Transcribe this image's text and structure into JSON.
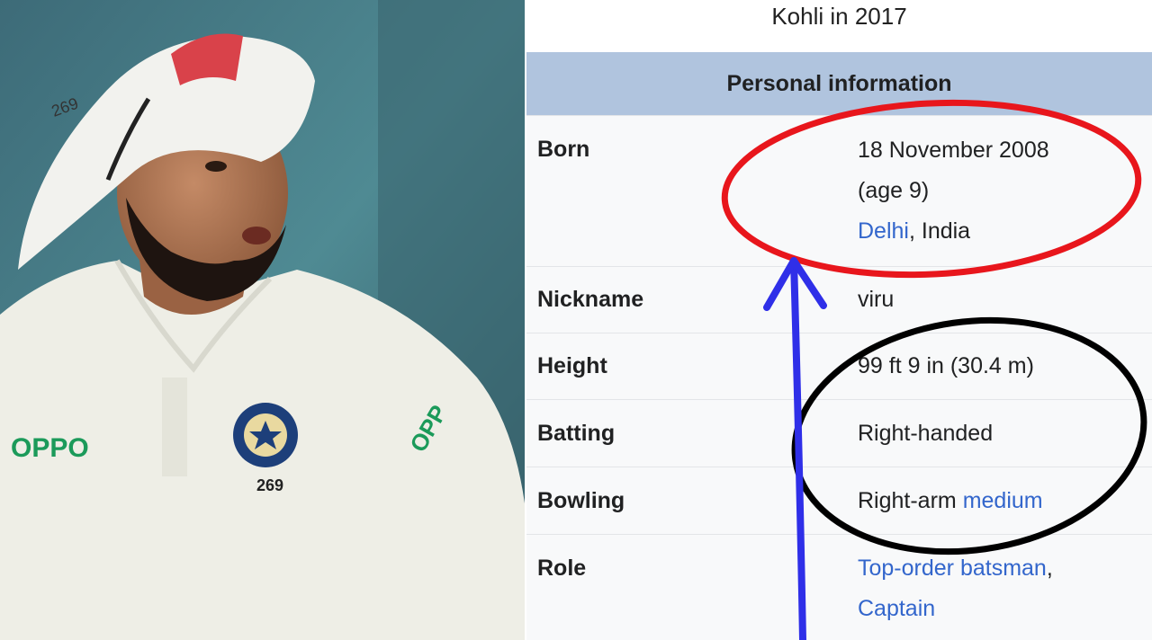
{
  "photo": {
    "cap_number": "269",
    "shirt_sponsor": "OPPO",
    "shirt_number": "269",
    "sleeve_sponsor": "OPP"
  },
  "infobox": {
    "caption": "Kohli in 2017",
    "section_title": "Personal information",
    "born": {
      "label": "Born",
      "date": "18 November 2008",
      "age": "(age 9)",
      "city": "Delhi",
      "country": ", India"
    },
    "nickname": {
      "label": "Nickname",
      "value": "viru"
    },
    "height": {
      "label": "Height",
      "value": "99 ft 9 in (30.4 m)"
    },
    "batting": {
      "label": "Batting",
      "value": "Right-handed"
    },
    "bowling": {
      "label": "Bowling",
      "prefix": "Right-arm ",
      "link": "medium"
    },
    "role": {
      "label": "Role",
      "link1": "Top-order batsman",
      "comma": ",",
      "link2": "Captain"
    }
  },
  "colors": {
    "header_bg": "#b0c4de",
    "link": "#3366cc",
    "red_annotation": "#e8161c",
    "black_annotation": "#000000",
    "arrow": "#2f2fe8"
  }
}
